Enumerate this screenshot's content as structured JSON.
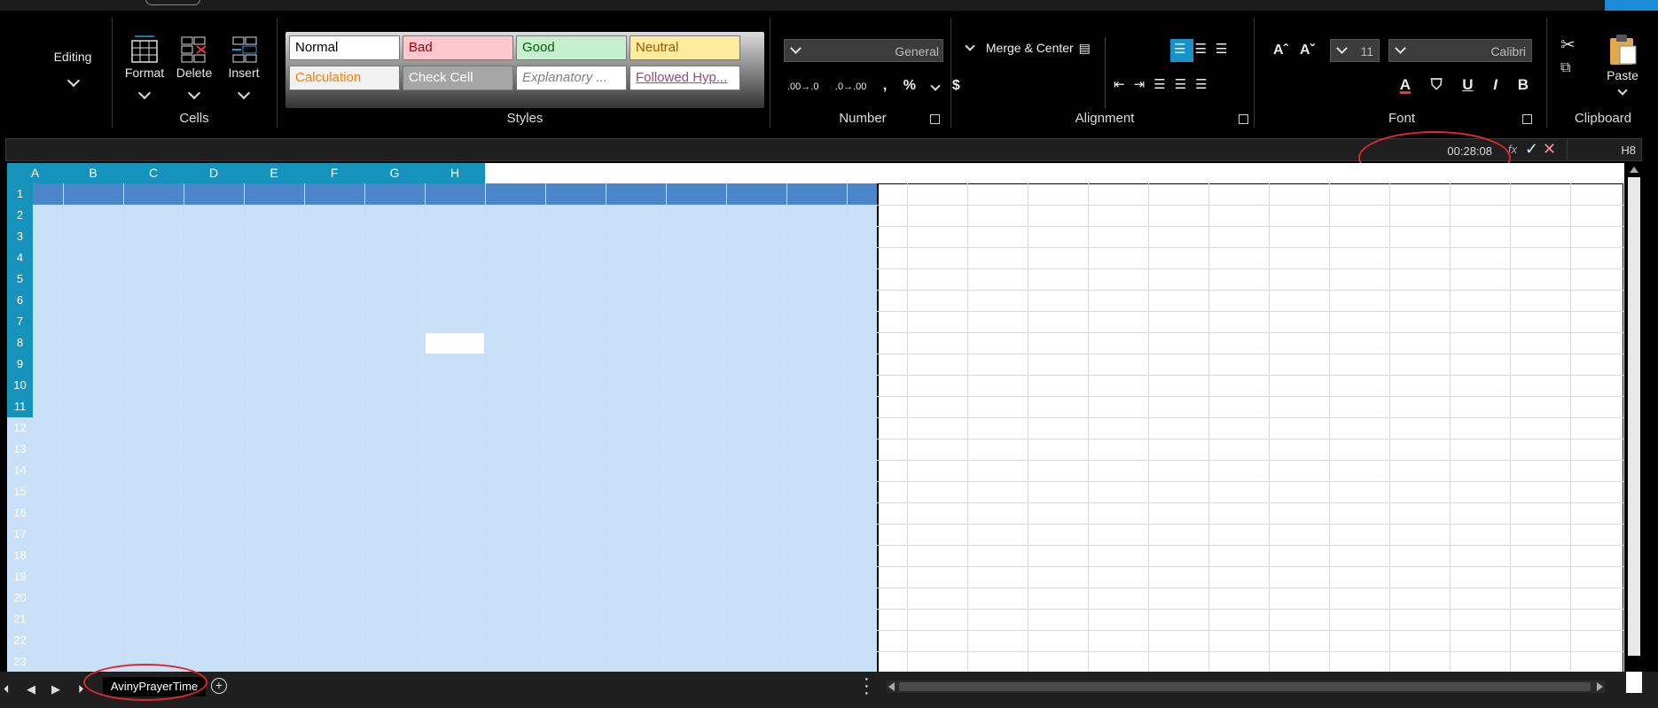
{
  "ribbon": {
    "editing": {
      "label": "Editing"
    },
    "cells": {
      "group_label": "Cells",
      "format_label": "Format",
      "delete_label": "Delete",
      "insert_label": "Insert"
    },
    "styles": {
      "group_label": "Styles",
      "items": [
        {
          "label": "Normal",
          "bg": "#ffffff",
          "fg": "#000000"
        },
        {
          "label": "Bad",
          "bg": "#ffc7ce",
          "fg": "#9c0006"
        },
        {
          "label": "Good",
          "bg": "#c6efce",
          "fg": "#006100"
        },
        {
          "label": "Neutral",
          "bg": "#ffeb9c",
          "fg": "#9c5700"
        },
        {
          "label": "Calculation",
          "bg": "#f2f2f2",
          "fg": "#fa7d00"
        },
        {
          "label": "Check Cell",
          "bg": "#a5a5a5",
          "fg": "#ffffff"
        },
        {
          "label": "Explanatory ...",
          "bg": "#ffffff",
          "fg": "#7f7f7f"
        },
        {
          "label": "Followed Hyp...",
          "bg": "#ffffff",
          "fg": "#954f72"
        }
      ]
    },
    "number": {
      "group_label": "Number",
      "format_value": "General",
      "tools": [
        ".00→.0",
        ".0→.00",
        ",",
        "%",
        "$"
      ]
    },
    "alignment": {
      "group_label": "Alignment",
      "merge_label": "Merge & Center"
    },
    "font": {
      "group_label": "Font",
      "size_value": "11",
      "family_value": "Calibri",
      "tools": [
        "A",
        "U",
        "I",
        "B"
      ]
    },
    "clipboard": {
      "group_label": "Clipboard",
      "paste_label": "Paste"
    }
  },
  "formula_bar": {
    "value": "00:28:08",
    "fx": "fx",
    "name_box": "H8"
  },
  "grid": {
    "columns": [
      "A",
      "B",
      "C",
      "D",
      "E",
      "F",
      "G",
      "H"
    ],
    "rows": [
      "1",
      "2",
      "3",
      "4",
      "5",
      "6",
      "7",
      "8",
      "9",
      "10",
      "11",
      "12",
      "13",
      "14",
      "15",
      "16",
      "17",
      "18",
      "19",
      "20",
      "21",
      "22",
      "23"
    ],
    "active_cell": "H8"
  },
  "sheets": {
    "tabs": [
      {
        "label": "AvinyPrayerTime",
        "active": true
      }
    ]
  },
  "colors": {
    "header_blue": "#1593bd",
    "selection_fill": "#c8e1f8",
    "row1_fill": "#4a86c9",
    "annotation_red": "#e0282d"
  }
}
